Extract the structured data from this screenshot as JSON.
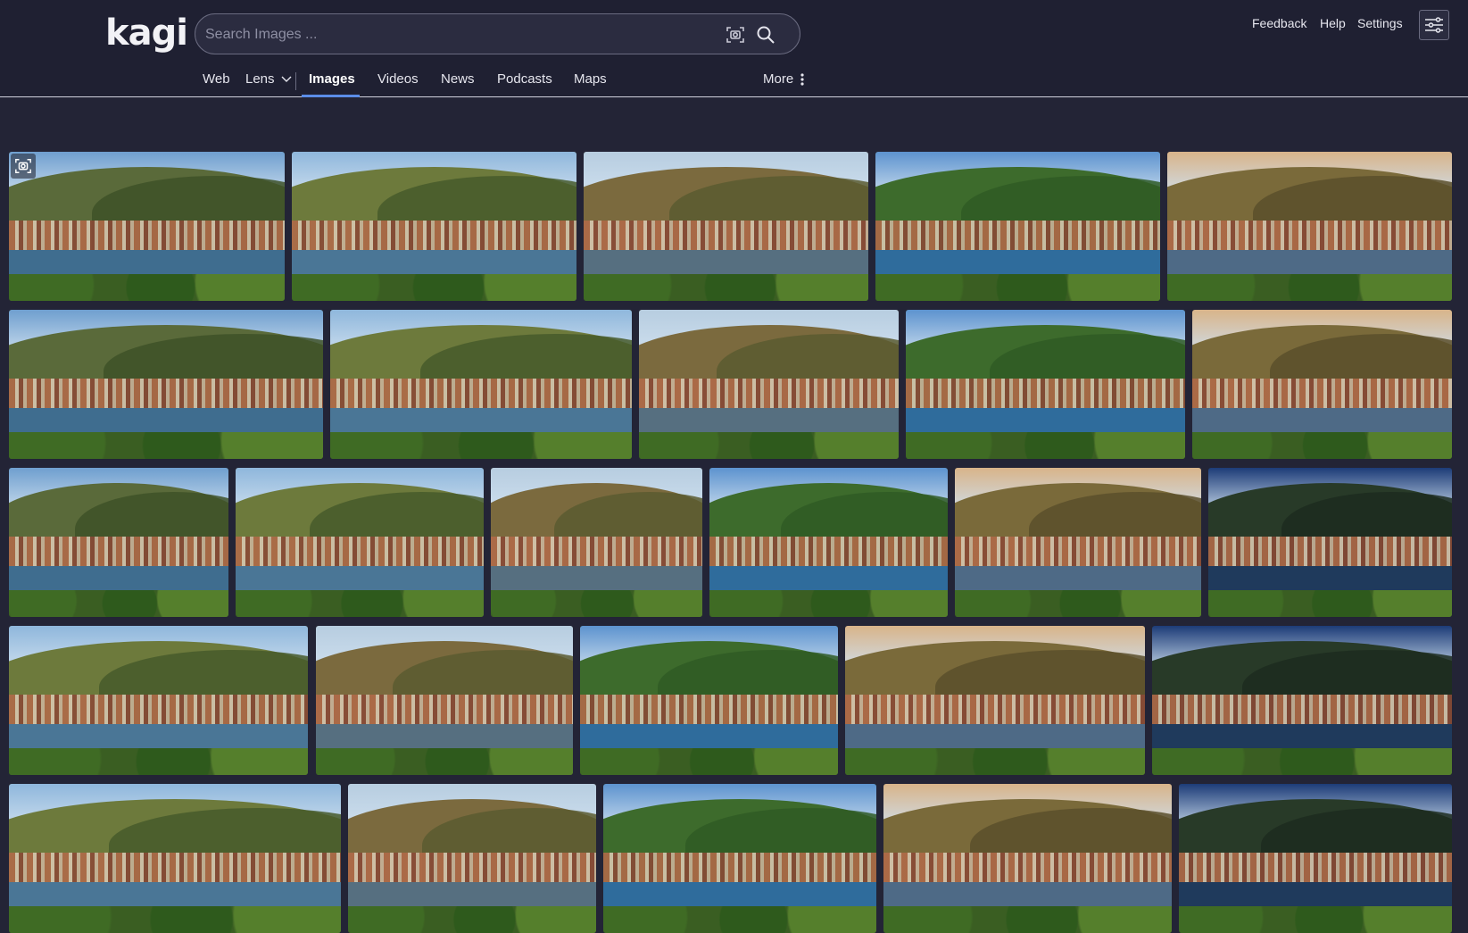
{
  "brand": {
    "logo_text": "kagi"
  },
  "search": {
    "placeholder": "Search Images ...",
    "value": ""
  },
  "top_links": {
    "feedback": "Feedback",
    "help": "Help",
    "settings": "Settings"
  },
  "tabs": {
    "web": "Web",
    "lens": "Lens",
    "images": "Images",
    "videos": "Videos",
    "news": "News",
    "podcasts": "Podcasts",
    "maps": "Maps",
    "more": "More"
  },
  "active_tab": "images",
  "icons": {
    "camera_search": "lens-camera-icon",
    "search": "search-icon",
    "settings": "sliders-icon",
    "lens_chevron": "chevron-down-icon",
    "more": "vertical-dots-icon"
  },
  "image_results": {
    "row_count_visible": 5,
    "tiles_per_row": [
      5,
      5,
      6,
      5,
      5
    ]
  },
  "colors": {
    "background": "#232436",
    "header": "#1f2032",
    "accent": "#5b8de8",
    "text": "#e6e6ee"
  }
}
